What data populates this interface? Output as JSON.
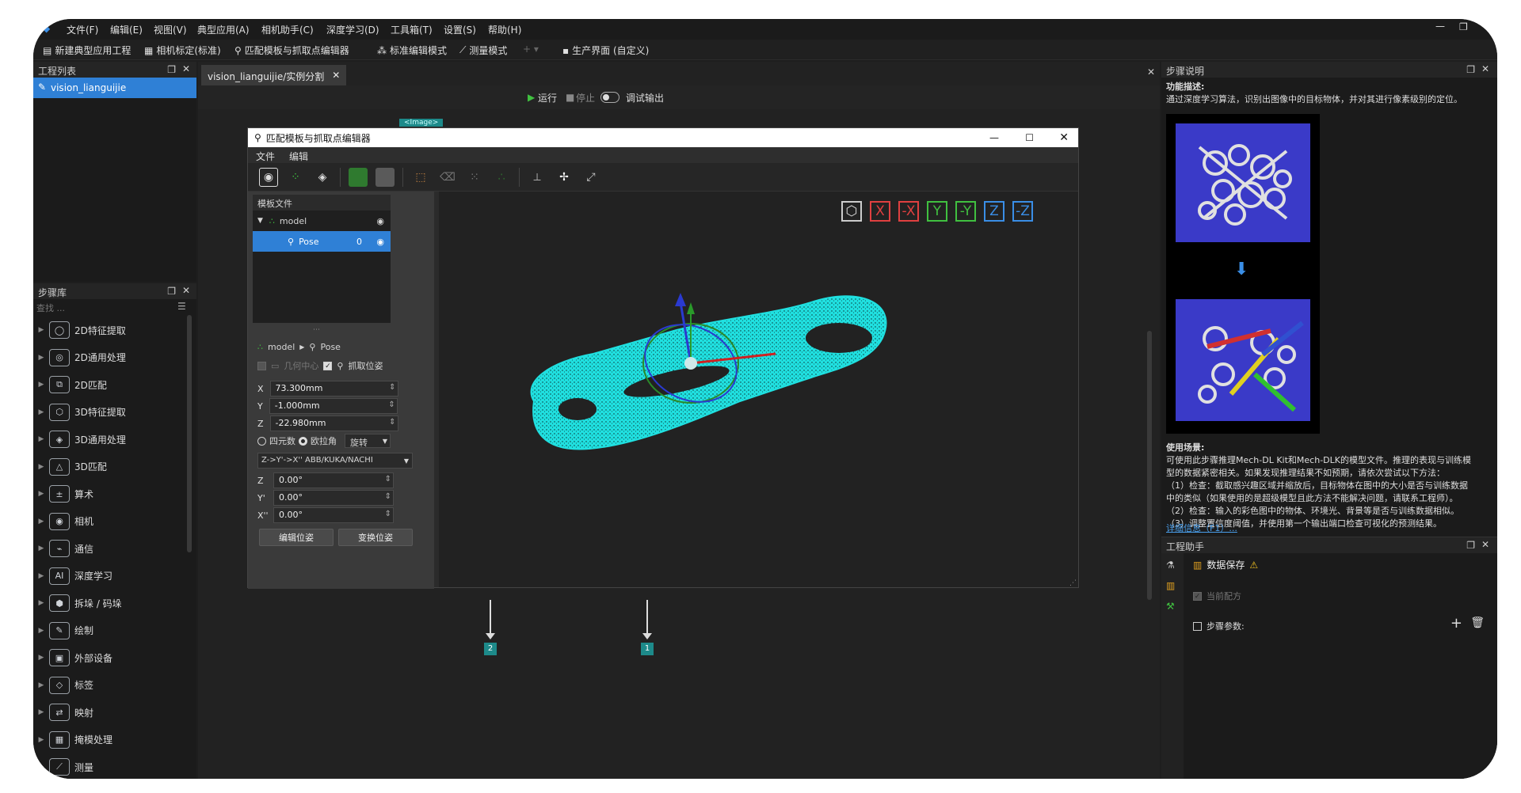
{
  "menu": [
    "文件(F)",
    "编辑(E)",
    "视图(V)",
    "典型应用(A)",
    "相机助手(C)",
    "深度学习(D)",
    "工具箱(T)",
    "设置(S)",
    "帮助(H)"
  ],
  "toolbar": {
    "new_project": "新建典型应用工程",
    "calibration": "相机标定(标准)",
    "matching_editor": "匹配模板与抓取点编辑器",
    "standard_mode": "标准编辑模式",
    "measure_mode": "测量模式",
    "production": "生产界面 (自定义)"
  },
  "project_panel": {
    "title": "工程列表",
    "item": "vision_lianguijie"
  },
  "step_lib": {
    "title": "步骤库",
    "search_placeholder": "查找 ...",
    "items": [
      {
        "label": "2D特征提取",
        "icon": "◯"
      },
      {
        "label": "2D通用处理",
        "icon": "◎"
      },
      {
        "label": "2D匹配",
        "icon": "⧉"
      },
      {
        "label": "3D特征提取",
        "icon": "⬡"
      },
      {
        "label": "3D通用处理",
        "icon": "◈"
      },
      {
        "label": "3D匹配",
        "icon": "△"
      },
      {
        "label": "算术",
        "icon": "±"
      },
      {
        "label": "相机",
        "icon": "◉"
      },
      {
        "label": "通信",
        "icon": "⌁"
      },
      {
        "label": "深度学习",
        "icon": "AI"
      },
      {
        "label": "拆垛 / 码垛",
        "icon": "⬢"
      },
      {
        "label": "绘制",
        "icon": "✎"
      },
      {
        "label": "外部设备",
        "icon": "▣"
      },
      {
        "label": "标签",
        "icon": "◇"
      },
      {
        "label": "映射",
        "icon": "⇄"
      },
      {
        "label": "掩模处理",
        "icon": "▦"
      },
      {
        "label": "测量",
        "icon": "⟋"
      }
    ]
  },
  "center": {
    "tab": "vision_lianguijie/实例分割",
    "run": "运行",
    "stop": "停止",
    "debug": "调试输出",
    "node_tag": "<Image>",
    "port2": "2",
    "port1": "1"
  },
  "dialog": {
    "title": "匹配模板与抓取点编辑器",
    "menu": [
      "文件",
      "编辑"
    ],
    "template_title": "模板文件",
    "tree_model": "model",
    "tree_pose": "Pose",
    "pose_value": "0",
    "crumb_model": "model",
    "crumb_pose": "Pose",
    "geo_center": "几何中心",
    "grasp_pose": "抓取位姿",
    "x_label": "X",
    "x_value": "73.300mm",
    "y_label": "Y",
    "y_value": "-1.000mm",
    "z_label": "Z",
    "z_value": "-22.980mm",
    "quaternion": "四元数",
    "euler": "欧拉角",
    "rotate": "旋转",
    "convention": "Z->Y'->X'' ABB/KUKA/NACHI",
    "rz_label": "Z",
    "rz_value": "0.00°",
    "ry_label": "Y'",
    "ry_value": "0.00°",
    "rx_label": "X''",
    "rx_value": "0.00°",
    "edit_pose": "编辑位姿",
    "transform_pose": "变换位姿",
    "axes": [
      "X",
      "-X",
      "Y",
      "-Y",
      "Z",
      "-Z"
    ],
    "axis_colors": [
      "#e04040",
      "#e04040",
      "#40c040",
      "#40c040",
      "#3a8ee6",
      "#3a8ee6"
    ]
  },
  "right_panel": {
    "title": "步骤说明",
    "func_title": "功能描述:",
    "func_desc": "通过深度学习算法，识别出图像中的目标物体，并对其进行像素级别的定位。",
    "usage_title": "使用场景:",
    "usage_lines": [
      "可使用此步骤推理Mech-DL Kit和Mech-DLK的模型文件。推理的表现与训练模",
      "型的数据紧密相关。如果发现推理结果不如预期，请依次尝试以下方法：",
      "（1）检查：截取感兴趣区域并缩放后，目标物体在图中的大小是否与训练数据",
      "中的类似（如果使用的是超级模型且此方法不能解决问题，请联系工程师）。",
      "（2）检查：输入的彩色图中的物体、环境光、背景等是否与训练数据相似。",
      "（3）调整置信度阈值，并使用第一个输出端口检查可视化的预测结果。"
    ],
    "more_link": "详细信息（F1）...",
    "assistant_title": "工程助手",
    "data_save": "数据保存",
    "current_recipe": "当前配方",
    "step_params": "步骤参数:"
  }
}
